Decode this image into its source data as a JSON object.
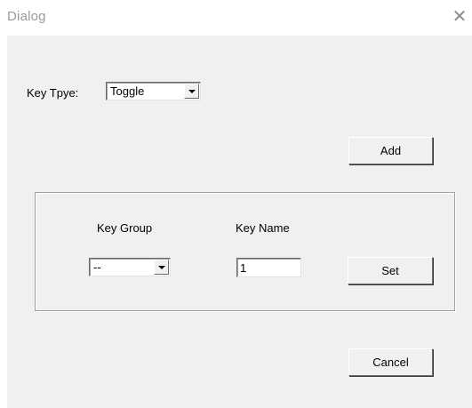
{
  "window": {
    "title": "Dialog",
    "close_glyph": "✕"
  },
  "key_type": {
    "label": "Key Tpye:",
    "selected": "Toggle"
  },
  "buttons": {
    "add": "Add",
    "set": "Set",
    "cancel": "Cancel"
  },
  "group": {
    "key_group_label": "Key Group",
    "key_group_selected": "--",
    "key_name_label": "Key Name",
    "key_name_value": "1"
  },
  "icons": {
    "close": "close-icon",
    "dropdown": "chevron-down-icon"
  },
  "colors": {
    "client_bg": "#f0f0f0",
    "title_text": "#9a9a9a"
  }
}
